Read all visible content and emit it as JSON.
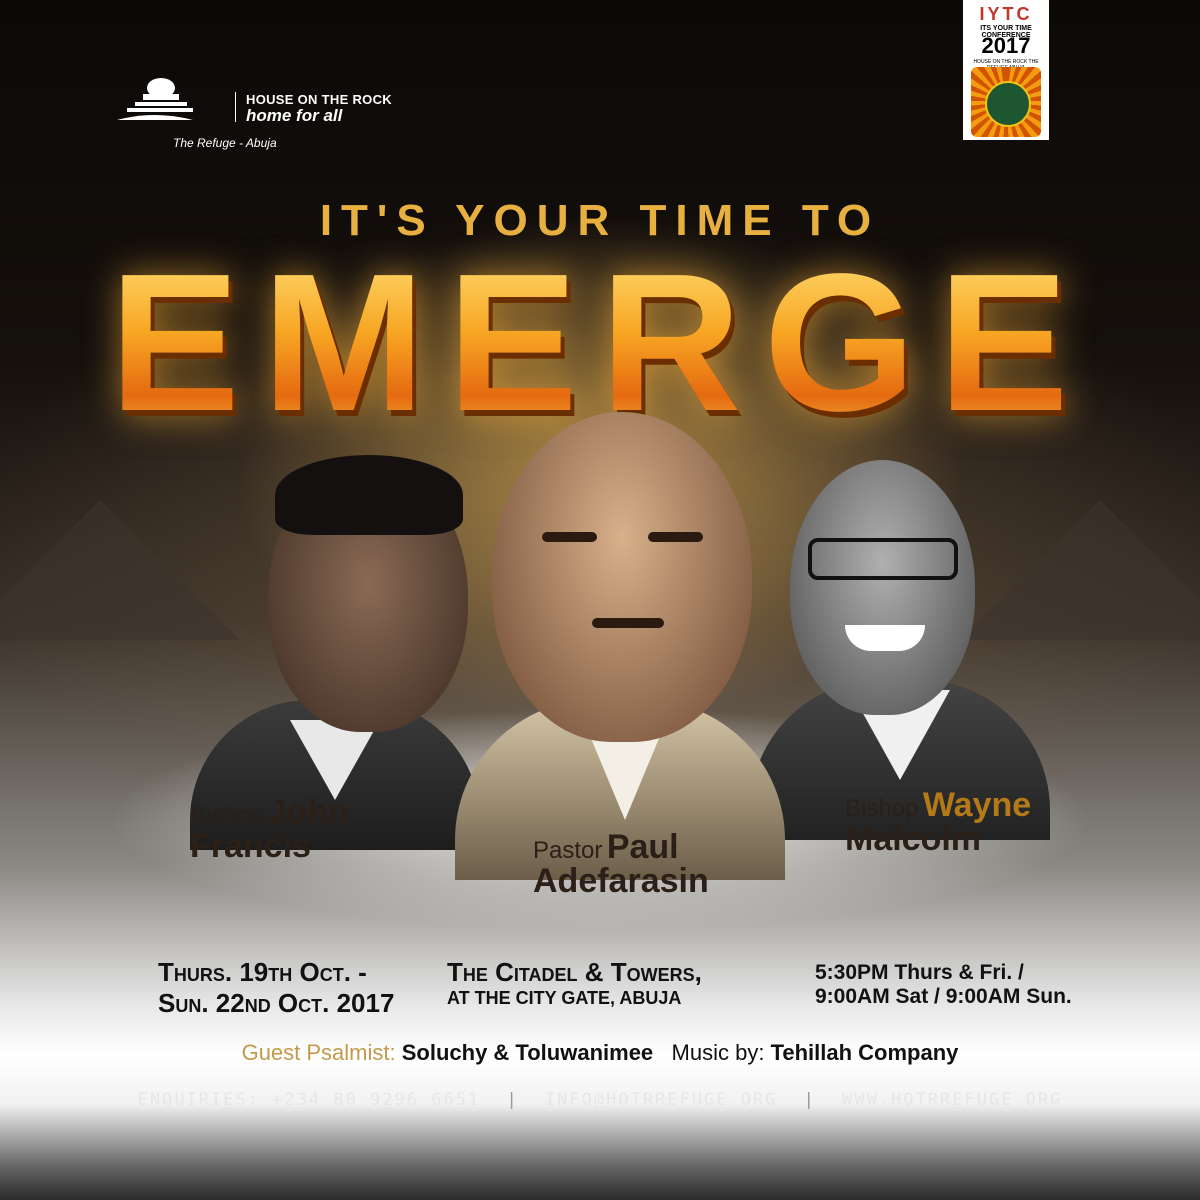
{
  "logo": {
    "org_name": "HOUSE ON THE ROCK",
    "slogan": "home for all",
    "branch": "The Refuge - Abuja"
  },
  "badge": {
    "acronym": "IYTC",
    "name": "ITS YOUR TIME CONFERENCE",
    "year": "2017",
    "sub": "HOUSE ON THE ROCK THE REFUGE ABUJA"
  },
  "headline": {
    "tagline": "IT'S YOUR TIME TO",
    "title": "EMERGE"
  },
  "speakers": [
    {
      "title": "Bishop",
      "first": "John",
      "last": "Francis"
    },
    {
      "title": "Pastor",
      "first": "Paul",
      "last": "Adefarasin"
    },
    {
      "title": "Bishop",
      "first": "Wayne",
      "last": "Malcolm"
    }
  ],
  "event": {
    "date_line1": "Thurs. 19th Oct. -",
    "date_line2": "Sun. 22nd Oct. 2017",
    "venue_line1": "The Citadel & Towers,",
    "venue_line2": "AT THE CITY GATE, ABUJA",
    "time_line1": "5:30PM Thurs & Fri. /",
    "time_line2": "9:00AM Sat / 9:00AM Sun."
  },
  "credits": {
    "psalmist_label": "Guest Psalmist:",
    "psalmist": "Soluchy & Toluwanimee",
    "music_label": "Music by:",
    "music": "Tehillah Company"
  },
  "contact": {
    "phone": "ENQUIRIES: +234 80 9296 6651",
    "email": "INFO@HOTRREFUGE.ORG",
    "website": "WWW.HOTRREFUGE.ORG"
  }
}
